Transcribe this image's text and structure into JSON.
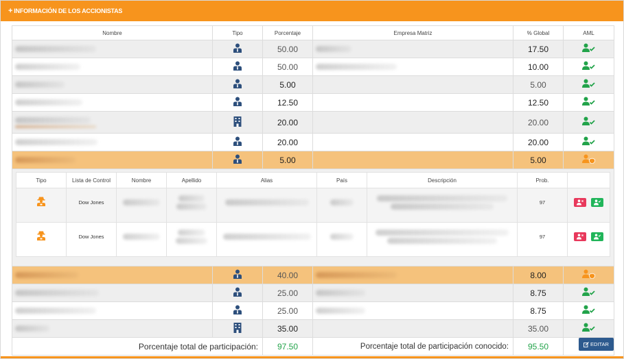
{
  "header": {
    "title": "INFORMACIÓN DE LOS ACCIONISTAS"
  },
  "columns": {
    "nombre": "Nombre",
    "tipo": "Tipo",
    "porcentaje": "Porcentaje",
    "empresa": "Empresa Matriz",
    "global": "% Global",
    "aml": "AML"
  },
  "rows": [
    {
      "tipo": "person-icon",
      "porcentaje": "50.00",
      "global": "17.50",
      "aml": "aml-ok"
    },
    {
      "tipo": "person-icon",
      "porcentaje": "50.00",
      "global": "10.00",
      "aml": "aml-ok"
    },
    {
      "tipo": "person-icon",
      "porcentaje": "5.00",
      "global": "5.00",
      "aml": "aml-ok"
    },
    {
      "tipo": "person-icon",
      "porcentaje": "12.50",
      "global": "12.50",
      "aml": "aml-ok"
    },
    {
      "tipo": "building-icon",
      "porcentaje": "20.00",
      "global": "20.00",
      "aml": "aml-ok"
    },
    {
      "tipo": "person-icon",
      "porcentaje": "20.00",
      "global": "20.00",
      "aml": "aml-ok"
    },
    {
      "tipo": "person-icon",
      "porcentaje": "5.00",
      "global": "5.00",
      "aml": "aml-alert"
    }
  ],
  "matches": {
    "columns": {
      "tipo": "Tipo",
      "lista": "Lista de Control",
      "nombre": "Nombre",
      "apellido": "Apellido",
      "alias": "Alias",
      "pais": "País",
      "descripcion": "Descripción",
      "prob": "Prob."
    },
    "items": [
      {
        "lista": "Dow Jones",
        "prob": "97"
      },
      {
        "lista": "Dow Jones",
        "prob": "97"
      }
    ]
  },
  "rows2": [
    {
      "tipo": "person-icon",
      "porcentaje": "40.00",
      "global": "8.00",
      "aml": "aml-alert"
    },
    {
      "tipo": "person-icon",
      "porcentaje": "25.00",
      "global": "8.75",
      "aml": "aml-ok"
    },
    {
      "tipo": "person-icon",
      "porcentaje": "25.00",
      "global": "8.75",
      "aml": "aml-ok"
    },
    {
      "tipo": "building-icon",
      "porcentaje": "35.00",
      "global": "35.00",
      "aml": "aml-ok"
    }
  ],
  "totals": {
    "participacion_label": "Porcentaje total de participación:",
    "participacion_value": "97.50",
    "conocido_label": "Porcentaje total de participación conocido:",
    "conocido_value": "95.50"
  },
  "edit_button": {
    "label": "EDITAR"
  },
  "colors": {
    "accent": "#f7941d",
    "highlight": "#f5c27c",
    "ok": "#22a34a",
    "primary": "#2d5a8e",
    "danger": "#e8395c"
  }
}
